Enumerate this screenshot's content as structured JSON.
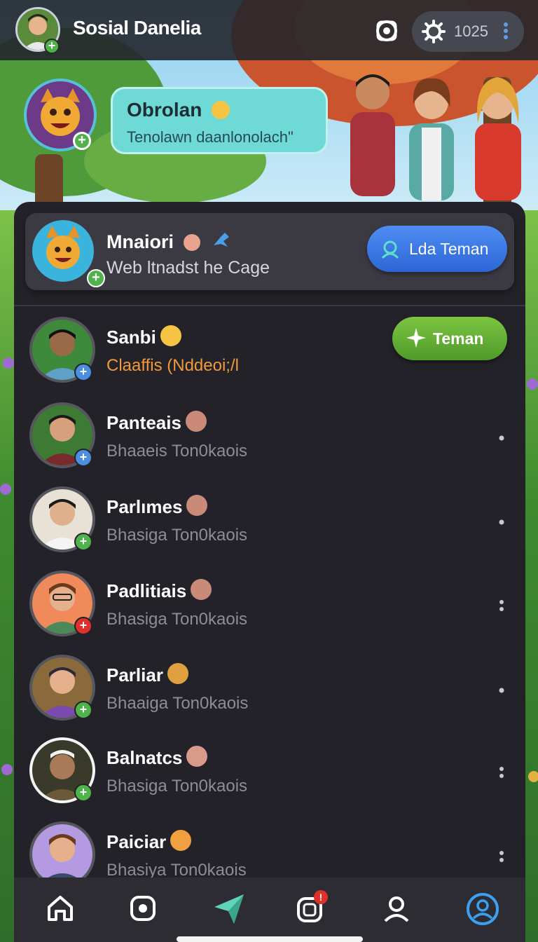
{
  "header": {
    "app_title": "Sosial Danelia",
    "counter": "1025",
    "icons": [
      "camera-icon",
      "gear-icon",
      "more-vertical-icon"
    ]
  },
  "banner": {
    "bubble_title": "Obrolan",
    "bubble_text": "Tenolawn daanlonolach\""
  },
  "featured": {
    "name": "Mnaiori",
    "status": "Web ltnadst he Cage",
    "button_label": "Lda Teman",
    "accent": "#2c66d6"
  },
  "friends": [
    {
      "name": "Sanbi",
      "status": "Claaffis (Nddeoi;/l",
      "action_label": "Teman",
      "status_color": "#f09a3a",
      "badge": "+",
      "badge_color": "#4a8fe0"
    },
    {
      "name": "Panteais",
      "status": "Bhaaeis Ton0kaois",
      "badge": "+",
      "badge_color": "#4a8fe0"
    },
    {
      "name": "Parlımes",
      "status": "Bhasiga Ton0kaois",
      "badge": "+",
      "badge_color": "#4fb24a"
    },
    {
      "name": "Padlitiais",
      "status": "Bhasiga Ton0kaois",
      "badge": "+",
      "badge_color": "#e0302a"
    },
    {
      "name": "Parliar",
      "status": "Bhaaiga Ton0kaois",
      "badge": "+",
      "badge_color": "#4fb24a"
    },
    {
      "name": "Balnatcs",
      "status": "Bhasiga Ton0kaois",
      "badge": "+",
      "badge_color": "#4fb24a"
    },
    {
      "name": "Paiciar",
      "status": "Bhasiya Ton0kaois",
      "badge": "",
      "badge_color": "#4a8fe0"
    }
  ],
  "bottom_nav": {
    "items": [
      "home-icon",
      "camera-icon",
      "send-icon",
      "notifications-icon",
      "profile-icon",
      "account-icon"
    ],
    "active": "account-icon",
    "notification_badge": "!"
  }
}
